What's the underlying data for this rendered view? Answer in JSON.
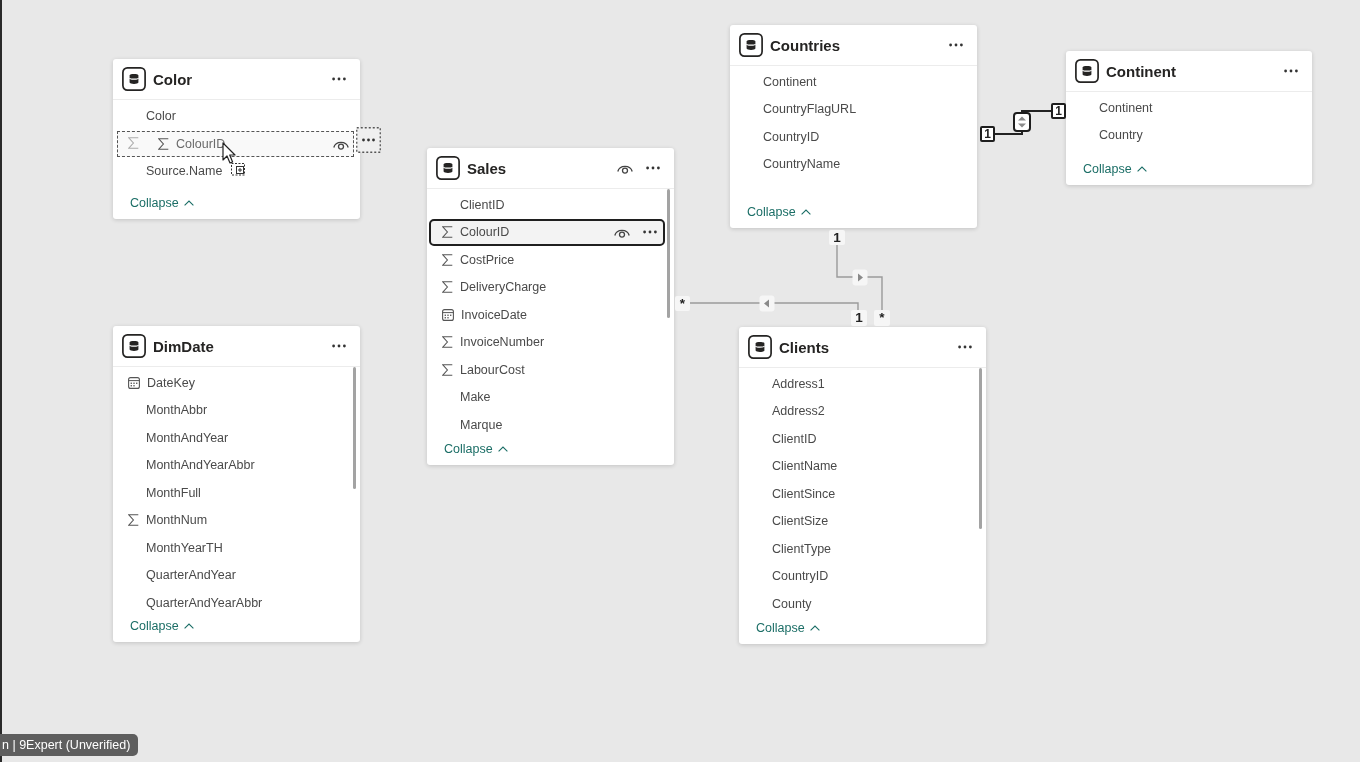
{
  "tables": [
    {
      "title": "Color",
      "hovered": false,
      "fields": [
        {
          "name": "Color",
          "kind": "text",
          "selected": false
        },
        {
          "kind": "number",
          "selected": false
        },
        {
          "name": "Source.Name",
          "kind": "text",
          "selected": false
        }
      ],
      "drag_preview": {
        "name": "ColourID",
        "kind": "number"
      },
      "collapse_label": "Collapse"
    },
    {
      "title": "Sales",
      "hovered": true,
      "fields": [
        {
          "name": "ClientID",
          "kind": "text",
          "selected": false
        },
        {
          "name": "ColourID",
          "kind": "number",
          "selected": true
        },
        {
          "name": "CostPrice",
          "kind": "number",
          "selected": false
        },
        {
          "name": "DeliveryCharge",
          "kind": "number",
          "selected": false
        },
        {
          "name": "InvoiceDate",
          "kind": "date",
          "selected": false
        },
        {
          "name": "InvoiceNumber",
          "kind": "number",
          "selected": false
        },
        {
          "name": "LabourCost",
          "kind": "number",
          "selected": false
        },
        {
          "name": "Make",
          "kind": "text",
          "selected": false
        },
        {
          "name": "Marque",
          "kind": "text",
          "selected": false
        }
      ],
      "collapse_label": "Collapse"
    },
    {
      "title": "Countries",
      "hovered": false,
      "fields": [
        {
          "name": "Continent",
          "kind": "text",
          "selected": false
        },
        {
          "name": "CountryFlagURL",
          "kind": "text",
          "selected": false
        },
        {
          "name": "CountryID",
          "kind": "text",
          "selected": false
        },
        {
          "name": "CountryName",
          "kind": "text",
          "selected": false
        }
      ],
      "collapse_label": "Collapse"
    },
    {
      "title": "Continent",
      "hovered": false,
      "fields": [
        {
          "name": "Continent",
          "kind": "text",
          "selected": false
        },
        {
          "name": "Country",
          "kind": "text",
          "selected": false
        }
      ],
      "collapse_label": "Collapse"
    },
    {
      "title": "DimDate",
      "hovered": false,
      "fields": [
        {
          "name": "DateKey",
          "kind": "date",
          "selected": false
        },
        {
          "name": "MonthAbbr",
          "kind": "text",
          "selected": false
        },
        {
          "name": "MonthAndYear",
          "kind": "text",
          "selected": false
        },
        {
          "name": "MonthAndYearAbbr",
          "kind": "text",
          "selected": false
        },
        {
          "name": "MonthFull",
          "kind": "text",
          "selected": false
        },
        {
          "name": "MonthNum",
          "kind": "number",
          "selected": false
        },
        {
          "name": "MonthYearTH",
          "kind": "text",
          "selected": false
        },
        {
          "name": "QuarterAndYear",
          "kind": "text",
          "selected": false
        },
        {
          "name": "QuarterAndYearAbbr",
          "kind": "text",
          "selected": false
        }
      ],
      "collapse_label": "Collapse"
    },
    {
      "title": "Clients",
      "hovered": false,
      "fields": [
        {
          "name": "Address1",
          "kind": "text",
          "selected": false
        },
        {
          "name": "Address2",
          "kind": "text",
          "selected": false
        },
        {
          "name": "ClientID",
          "kind": "text",
          "selected": false
        },
        {
          "name": "ClientName",
          "kind": "text",
          "selected": false
        },
        {
          "name": "ClientSince",
          "kind": "text",
          "selected": false
        },
        {
          "name": "ClientSize",
          "kind": "text",
          "selected": false
        },
        {
          "name": "ClientType",
          "kind": "text",
          "selected": false
        },
        {
          "name": "CountryID",
          "kind": "text",
          "selected": false
        },
        {
          "name": "County",
          "kind": "text",
          "selected": false
        }
      ],
      "collapse_label": "Collapse"
    }
  ],
  "relationships": [
    {
      "ends": [
        "1",
        "1"
      ],
      "kind": "both",
      "highlighted": true
    },
    {
      "ends": [
        "1",
        "*"
      ],
      "kind": "single",
      "highlighted": false
    },
    {
      "ends": [
        "1",
        "*"
      ],
      "kind": "single",
      "highlighted": false
    }
  ],
  "name_tag": {
    "text": "n | 9Expert (Unverified)"
  }
}
